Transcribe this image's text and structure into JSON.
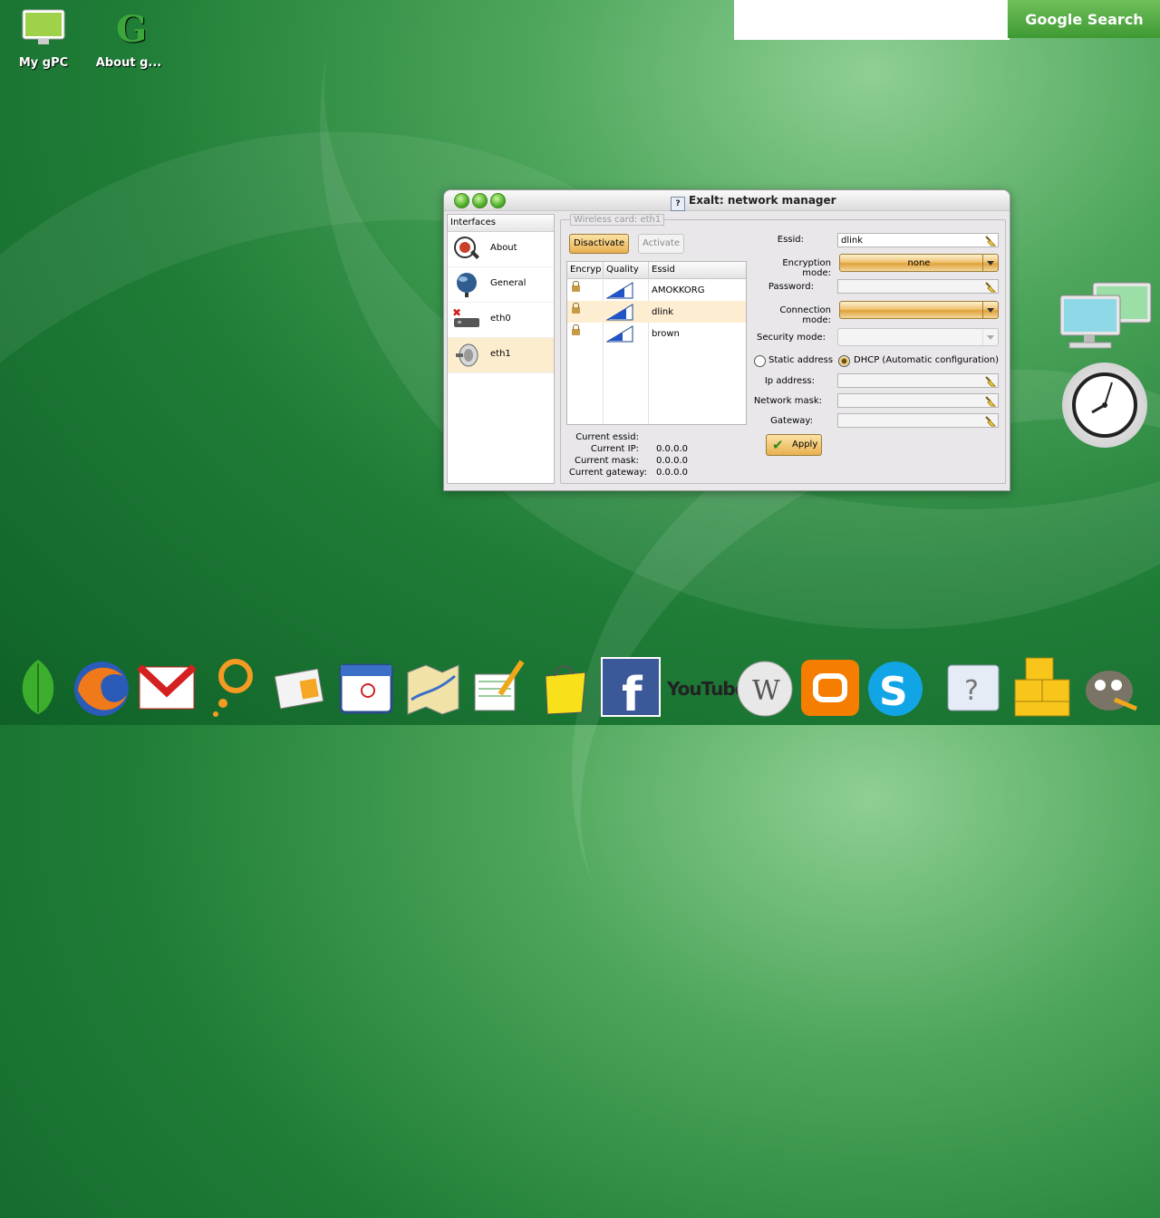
{
  "desktop": {
    "icons": [
      {
        "label": "My gPC"
      },
      {
        "label": "About g..."
      }
    ],
    "search": {
      "placeholder": "",
      "button_label": "Google Search"
    }
  },
  "window": {
    "title": "Exalt: network manager",
    "sidebar": {
      "header": "Interfaces",
      "items": [
        {
          "label": "About",
          "icon": "about-icon"
        },
        {
          "label": "General",
          "icon": "globe-icon"
        },
        {
          "label": "eth0",
          "icon": "ethernet-disconnected-icon"
        },
        {
          "label": "eth1",
          "icon": "wireless-antenna-icon",
          "selected": true
        }
      ]
    },
    "panel": {
      "legend": "Wireless card: eth1",
      "deactivate_label": "Disactivate",
      "activate_label": "Activate",
      "table": {
        "columns": [
          "Encryp",
          "Quality",
          "Essid"
        ],
        "rows": [
          {
            "essid": "AMOKKORG",
            "encrypted": true
          },
          {
            "essid": "dlink",
            "encrypted": true,
            "selected": true
          },
          {
            "essid": "brown",
            "encrypted": true
          }
        ]
      },
      "info": {
        "current_essid_label": "Current essid:",
        "current_essid": "",
        "current_ip_label": "Current IP:",
        "current_ip": "0.0.0.0",
        "current_mask_label": "Current mask:",
        "current_mask": "0.0.0.0",
        "current_gateway_label": "Current gateway:",
        "current_gateway": "0.0.0.0"
      },
      "form": {
        "essid_label": "Essid:",
        "essid_value": "dlink",
        "encryption_label": "Encryption mode:",
        "encryption_value": "none",
        "password_label": "Password:",
        "password_value": "",
        "connection_label": "Connection mode:",
        "connection_value": "",
        "security_label": "Security mode:",
        "security_value": "",
        "static_label": "Static address",
        "dhcp_label": "DHCP (Automatic configuration)",
        "ip_label": "Ip address:",
        "mask_label": "Network mask:",
        "gateway_label": "Gateway:",
        "apply_label": "Apply"
      }
    }
  },
  "dock": {
    "items": [
      "leaf-icon",
      "firefox-icon",
      "gmail-icon",
      "search-ring-icon",
      "news-icon",
      "calendar-icon",
      "maps-icon",
      "docs-icon",
      "shopping-bag-icon",
      "facebook-icon",
      "youtube-icon",
      "wikipedia-icon",
      "blogger-icon",
      "skype-icon",
      "help-icon",
      "sudoku-icon",
      "gimp-icon"
    ],
    "youtube_text": "YouTube"
  },
  "colors": {
    "accent": "#3f9a33",
    "button_gold": "#e9b04f",
    "selection": "#fdedcf"
  }
}
